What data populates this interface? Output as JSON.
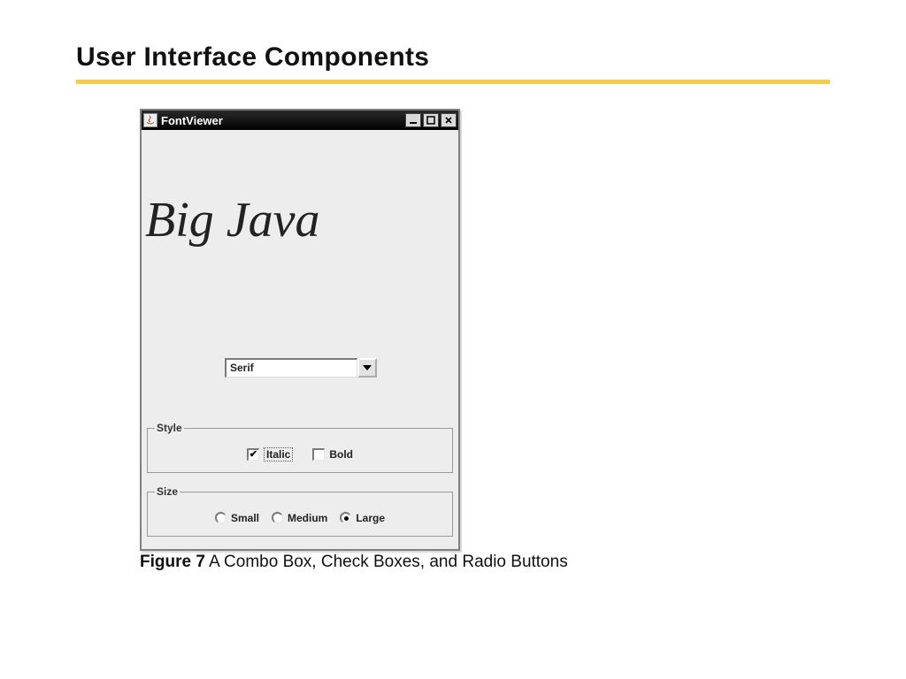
{
  "slide": {
    "title": "User Interface Components"
  },
  "window": {
    "title": "FontViewer",
    "preview_text": "Big Java",
    "combo": {
      "selected": "Serif"
    },
    "style": {
      "legend": "Style",
      "italic": {
        "label": "Italic",
        "checked": true
      },
      "bold": {
        "label": "Bold",
        "checked": false
      }
    },
    "size": {
      "legend": "Size",
      "options": {
        "small": {
          "label": "Small",
          "selected": false
        },
        "medium": {
          "label": "Medium",
          "selected": false
        },
        "large": {
          "label": "Large",
          "selected": true
        }
      }
    }
  },
  "caption": {
    "fignum": "Figure 7",
    "text": " A Combo Box, Check Boxes, and Radio Buttons"
  }
}
